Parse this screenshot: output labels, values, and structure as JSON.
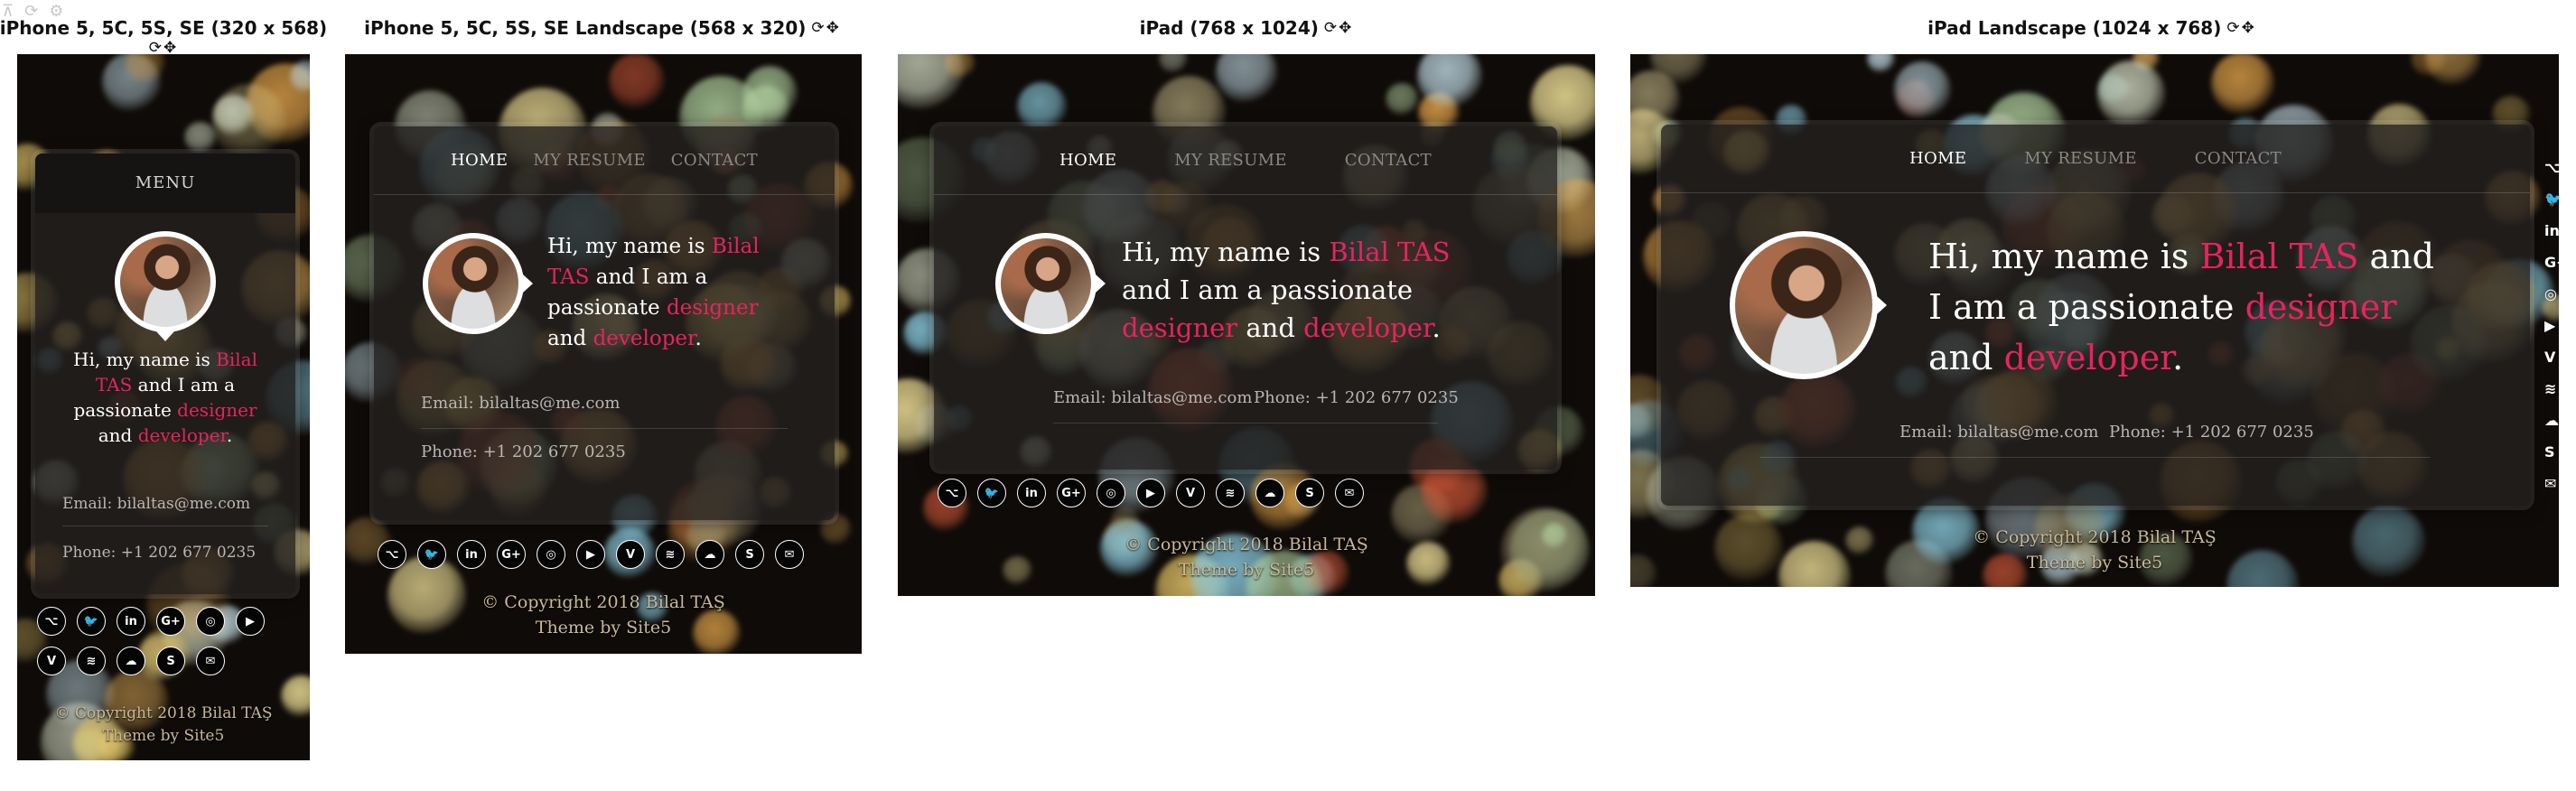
{
  "toolbar": {
    "pin_glyph": "⊼",
    "refresh_glyph": "⟳",
    "settings_glyph": "⚙"
  },
  "devices": [
    {
      "label": "iPhone 5, 5C, 5S, SE (320 x 568)"
    },
    {
      "label": "iPhone 5, 5C, 5S, SE Landscape (568 x 320)"
    },
    {
      "label": "iPad (768 x 1024)"
    },
    {
      "label": "iPad Landscape (1024 x 768)"
    }
  ],
  "label_icons": "⟳✥",
  "site": {
    "menu_label": "MENU",
    "nav": [
      "HOME",
      "MY RESUME",
      "CONTACT"
    ],
    "intro": {
      "greeting": "Hi, my name is ",
      "name": "Bilal TAS",
      "name_first": "Bilal",
      "name_last": "TAS",
      "middle": " and I am a passionate ",
      "middle_a": "and I am a",
      "middle_b": "passionate",
      "role1": "designer",
      "and": " and ",
      "and_word": "and",
      "role2": "developer",
      "period": "."
    },
    "email": "Email: bilaltas@me.com",
    "phone": "Phone: +1 202 677 0235",
    "footer_copyright": "© Copyright 2018 Bilal TAŞ",
    "footer_theme": "Theme by Site5",
    "socials": [
      {
        "name": "github-icon",
        "glyph": "⌥"
      },
      {
        "name": "twitter-icon",
        "glyph": "🐦"
      },
      {
        "name": "linkedin-icon",
        "glyph": "in"
      },
      {
        "name": "google-plus-icon",
        "glyph": "G+"
      },
      {
        "name": "instagram-icon",
        "glyph": "◎"
      },
      {
        "name": "youtube-icon",
        "glyph": "▶"
      },
      {
        "name": "vimeo-icon",
        "glyph": "V"
      },
      {
        "name": "spotify-icon",
        "glyph": "≋"
      },
      {
        "name": "soundcloud-icon",
        "glyph": "☁"
      },
      {
        "name": "skype-icon",
        "glyph": "S"
      },
      {
        "name": "email-icon",
        "glyph": "✉"
      }
    ],
    "edge_socials": [
      "⌥",
      "🐦",
      "in",
      "G+",
      "◎",
      "▶",
      "V",
      "≋",
      "☁",
      "S",
      "✉"
    ]
  },
  "colors": {
    "accent": "#e5245e",
    "card": "#23211f",
    "footer": "#c9b998"
  }
}
